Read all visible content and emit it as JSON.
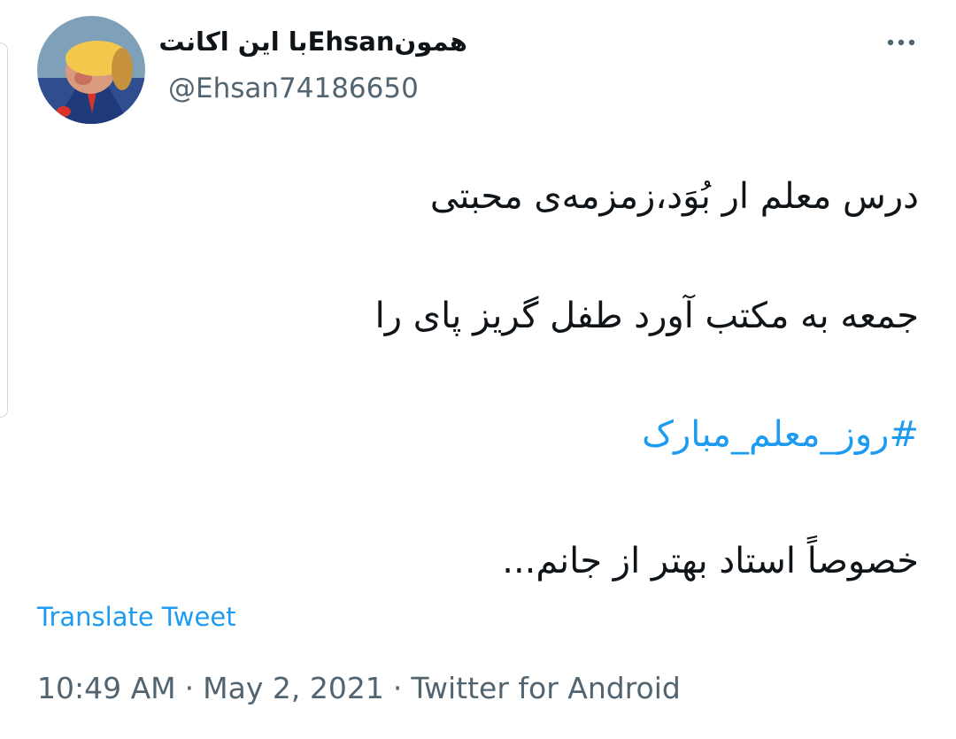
{
  "tweet": {
    "display_name": "همونEhsanبا این اکانت",
    "handle": "@Ehsan74186650",
    "more_icon": "more-horizontal-icon",
    "lines": [
      "درس معلم ار بُوَد،زمزمه‌ی محبتی",
      "جمعه به مکتب آورد طفل گریز پای را"
    ],
    "hashtag": "#روز_معلم_مبارک",
    "closing_line": "خصوصاً استاد بهتر از جانم...",
    "translate_label": "Translate Tweet",
    "time": "10:49 AM",
    "date": "May 2, 2021",
    "separator": "·",
    "source": "Twitter for Android"
  },
  "colors": {
    "text_primary": "#0f1419",
    "text_secondary": "#536471",
    "link": "#1d9bf0",
    "background": "#ffffff"
  }
}
